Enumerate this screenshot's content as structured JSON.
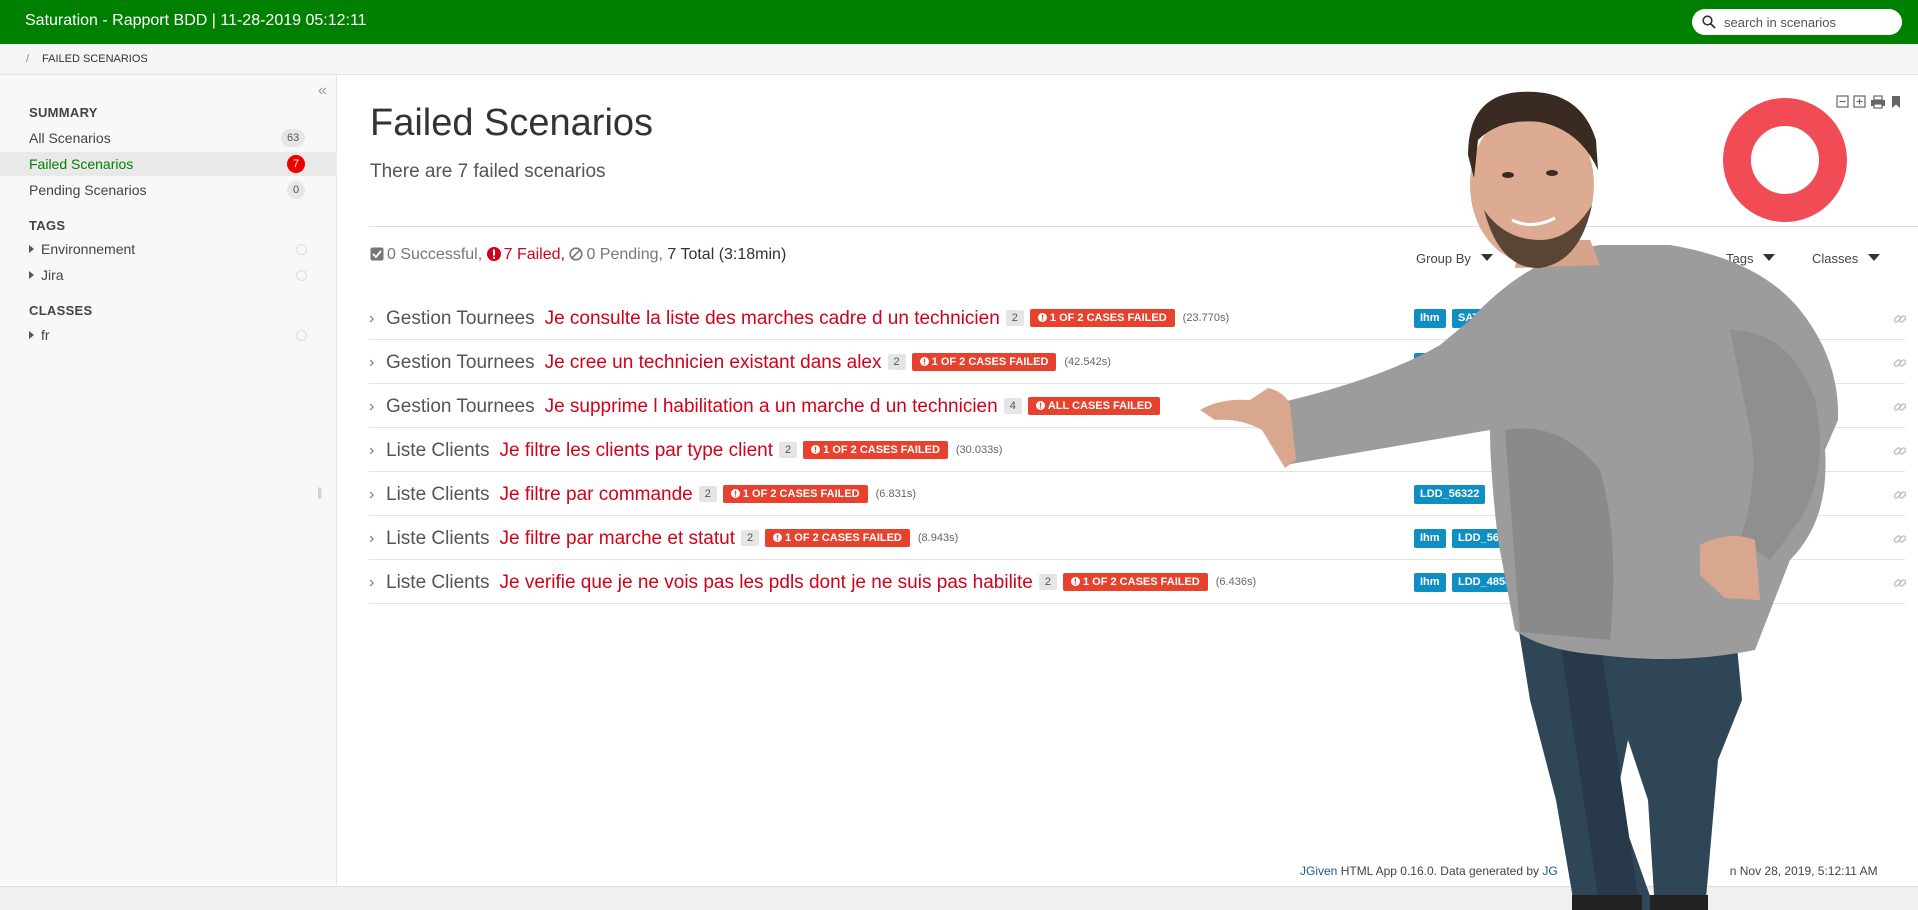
{
  "header": {
    "title": "Saturation - Rapport BDD | 11-28-2019 05:12:11",
    "search_placeholder": "search in scenarios"
  },
  "breadcrumb": {
    "separator": "/",
    "current": "FAILED SCENARIOS"
  },
  "sidebar": {
    "summary_heading": "SUMMARY",
    "summary_items": [
      {
        "label": "All Scenarios",
        "count": "63"
      },
      {
        "label": "Failed Scenarios",
        "count": "7"
      },
      {
        "label": "Pending Scenarios",
        "count": "0"
      }
    ],
    "tags_heading": "TAGS",
    "tags": [
      {
        "label": "Environnement"
      },
      {
        "label": "Jira"
      }
    ],
    "classes_heading": "CLASSES",
    "classes": [
      {
        "label": "fr"
      }
    ]
  },
  "main": {
    "title": "Failed Scenarios",
    "subtitle": "There are 7 failed scenarios",
    "summary": {
      "successful": "0 Successful,",
      "failed": "7 Failed,",
      "pending": "0 Pending,",
      "total": "7 Total (3:18min)"
    },
    "controls": {
      "group_by": "Group By",
      "tags": "Tags",
      "classes": "Classes"
    },
    "scenarios": [
      {
        "cls": "Gestion Tournees",
        "name": "Je consulte la liste des marches cadre d un technicien",
        "cases": "2",
        "status": "1 OF 2 CASES FAILED",
        "duration": "(23.770s)",
        "tags": [
          "Ihm",
          "SAT"
        ]
      },
      {
        "cls": "Gestion Tournees",
        "name": "Je cree un technicien existant dans alex",
        "cases": "2",
        "status": "1 OF 2 CASES FAILED",
        "duration": "(42.542s)",
        "tags": [
          "Ihm"
        ]
      },
      {
        "cls": "Gestion Tournees",
        "name": "Je supprime l habilitation a un marche d un technicien",
        "cases": "4",
        "status": "ALL CASES FAILED",
        "duration": "",
        "tags": [
          "Ihm"
        ]
      },
      {
        "cls": "Liste Clients",
        "name": "Je filtre les clients par type client",
        "cases": "2",
        "status": "1 OF 2 CASES FAILED",
        "duration": "(30.033s)",
        "tags": []
      },
      {
        "cls": "Liste Clients",
        "name": "Je filtre par commande",
        "cases": "2",
        "status": "1 OF 2 CASES FAILED",
        "duration": "(6.831s)",
        "tags": [
          "LDD_56322"
        ]
      },
      {
        "cls": "Liste Clients",
        "name": "Je filtre par marche et statut",
        "cases": "2",
        "status": "1 OF 2 CASES FAILED",
        "duration": "(8.943s)",
        "tags": [
          "Ihm",
          "LDD_56325"
        ]
      },
      {
        "cls": "Liste Clients",
        "name": "Je verifie que je ne vois pas les pdls dont je ne suis pas habilite",
        "cases": "2",
        "status": "1 OF 2 CASES FAILED",
        "duration": "(6.436s)",
        "tags": [
          "Ihm",
          "LDD_4858"
        ]
      }
    ]
  },
  "footer": {
    "brand": "JGiven",
    "text": " HTML App 0.16.0. Data generated by ",
    "brand2": "JG",
    "date": "n Nov 28, 2019, 5:12:11 AM"
  },
  "colors": {
    "header": "#008000",
    "failed": "#d0021b",
    "badge": "#e8412d",
    "tag": "#0f8ec4",
    "donut": "#f14b55"
  }
}
